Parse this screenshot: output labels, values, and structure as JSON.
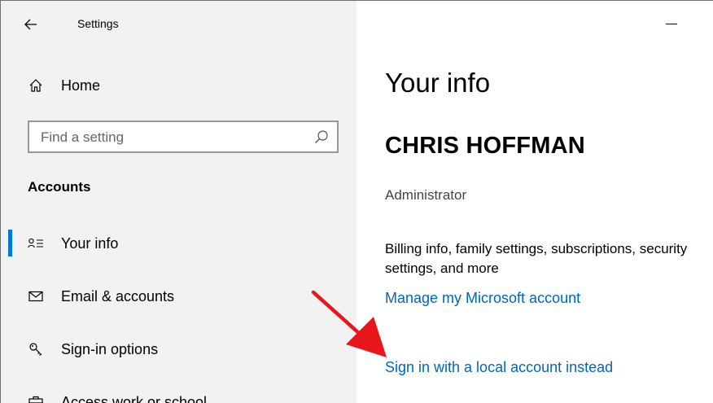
{
  "window": {
    "title": "Settings"
  },
  "sidebar": {
    "home_label": "Home",
    "search_placeholder": "Find a setting",
    "section_heading": "Accounts",
    "items": [
      {
        "label": "Your info",
        "icon": "person-list-icon",
        "selected": true
      },
      {
        "label": "Email & accounts",
        "icon": "mail-icon"
      },
      {
        "label": "Sign-in options",
        "icon": "key-icon"
      },
      {
        "label": "Access work or school",
        "icon": "briefcase-icon"
      }
    ]
  },
  "main": {
    "page_title": "Your info",
    "user_name": "CHRIS HOFFMAN",
    "user_role": "Administrator",
    "description_line1": "Billing info, family settings, subscriptions, security",
    "description_line2": "settings, and more",
    "manage_link": "Manage my Microsoft account",
    "local_link": "Sign in with a local account instead"
  },
  "colors": {
    "accent": "#0078d7",
    "link": "#0067b8",
    "sidebar_bg": "#f2f2f2",
    "arrow": "#e8161b"
  }
}
